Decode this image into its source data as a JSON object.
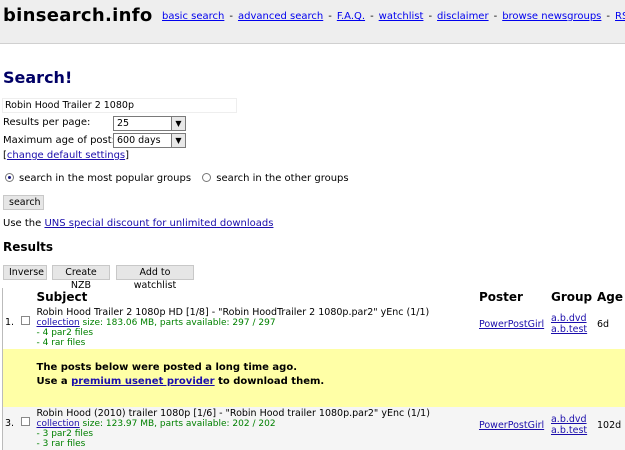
{
  "site": {
    "logo": "binsearch.info",
    "nav": [
      "basic search",
      "advanced search",
      "F.A.Q.",
      "watchlist",
      "disclaimer",
      "browse newsgroups",
      "RSS"
    ]
  },
  "search": {
    "heading": "Search!",
    "query": "Robin Hood Trailer 2 1080p",
    "results_per_page_label": "Results per page:",
    "results_per_page": "25",
    "max_age_label": "Maximum age of post:",
    "max_age": "600 days",
    "change_defaults": "change default settings",
    "groups_options": [
      "search in the most popular groups",
      "search in the other groups"
    ],
    "selected_group_option": 0,
    "search_button": "search",
    "uns_prefix": "Use the ",
    "uns_link": "UNS special discount for unlimited downloads"
  },
  "results": {
    "heading": "Results",
    "actions": [
      "Inverse",
      "Create NZB",
      "Add to watchlist"
    ],
    "columns": [
      "Subject",
      "Poster",
      "Group",
      "Age"
    ],
    "rows": [
      {
        "num": "1.",
        "subject": "Robin Hood Trailer 2 1080p HD [1/8] - \"Robin HoodTrailer 2 1080p.par2\" yEnc (1/1)",
        "collection": "collection",
        "meta": " size: 183.06 MB, parts available: 297 / 297",
        "files": [
          "- 4 par2 files",
          "- 4 rar files"
        ],
        "poster": "PowerPostGirl",
        "groups": [
          "a.b.dvd",
          "a.b.test"
        ],
        "age": "6d"
      },
      {
        "num": "3.",
        "subject": "Robin Hood (2010) trailer 1080p [1/6] - \"Robin Hood trailer 1080p.par2\" yEnc (1/1)",
        "collection": "collection",
        "meta": " size: 123.97 MB, parts available: 202 / 202",
        "files": [
          "- 3 par2 files",
          "- 3 rar files"
        ],
        "poster": "PowerPostGirl",
        "groups": [
          "a.b.dvd",
          "a.b.test"
        ],
        "age": "102d"
      }
    ],
    "notice": {
      "line1": "The posts below were posted a long time ago.",
      "line2_prefix": "Use a ",
      "line2_link": "premium usenet provider",
      "line2_suffix": " to download them."
    }
  }
}
